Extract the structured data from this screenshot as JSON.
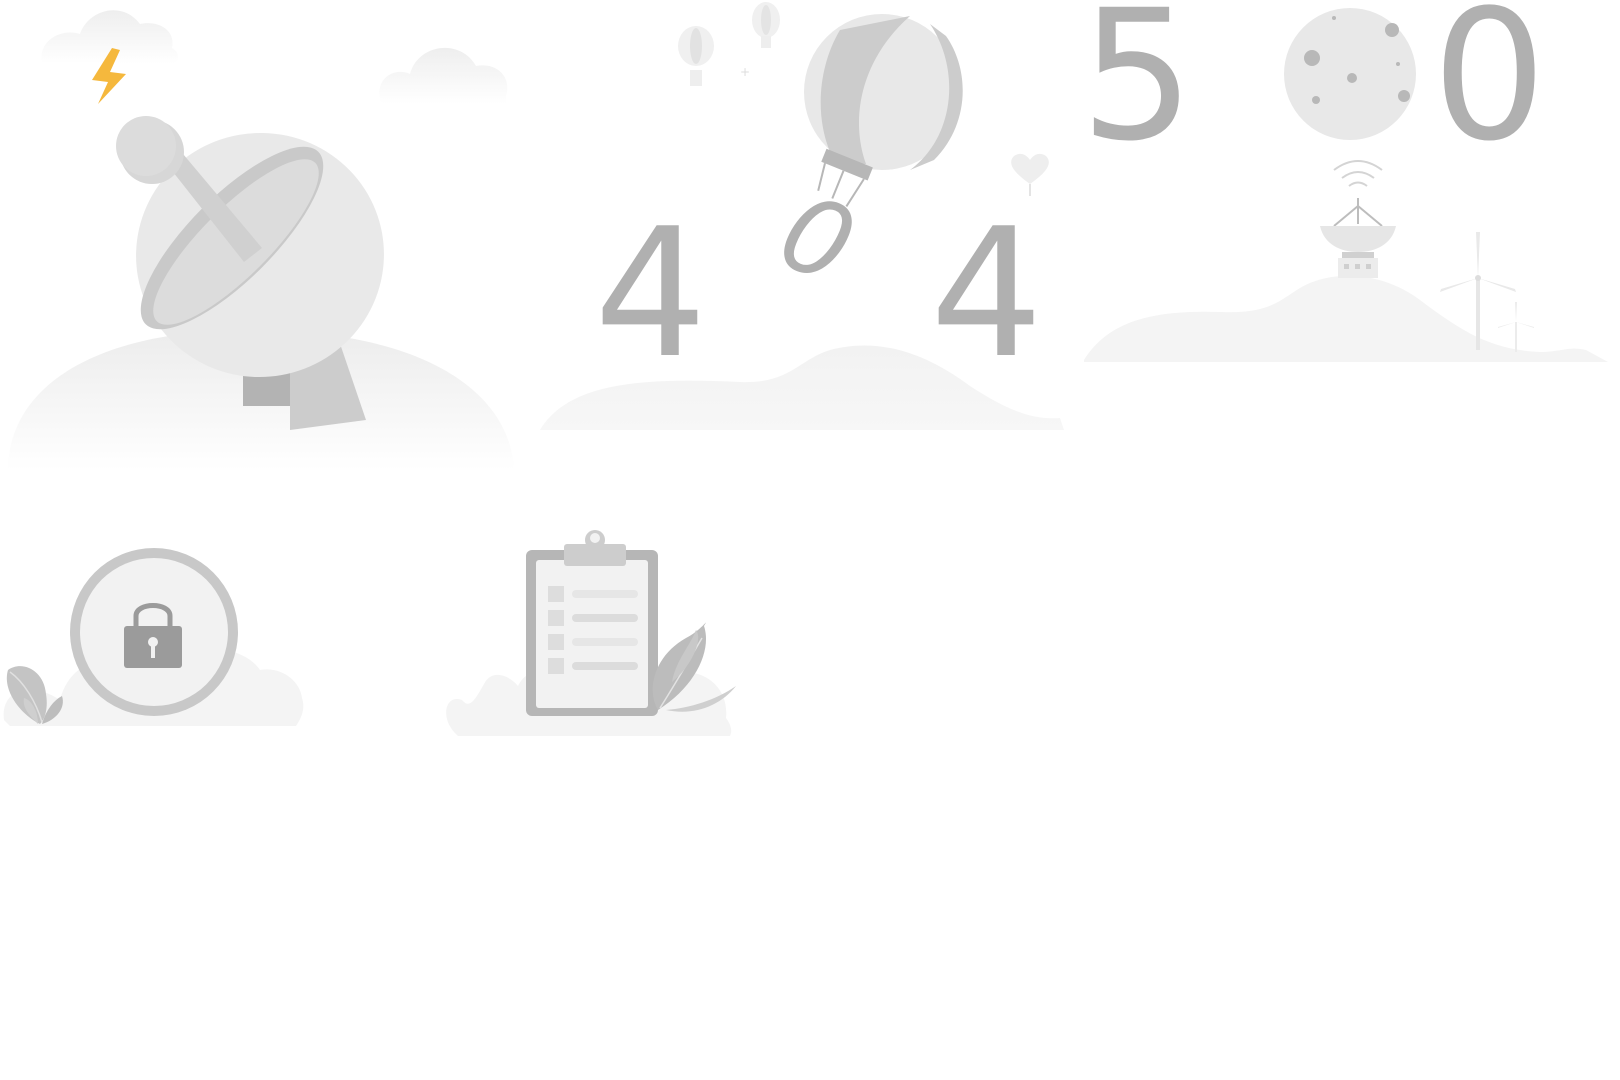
{
  "colors": {
    "background": "#ffffff",
    "digit": "#b0b0b0",
    "light_fill": "#e9e9e9",
    "mid_fill": "#cbcbcb",
    "dark_fill": "#9b9b9b",
    "ground": "#f4f4f4",
    "lightning": "#f5b83d"
  },
  "illustrations": {
    "network_error": {
      "icons": [
        "cloud-icon",
        "lightning-icon",
        "satellite-dish-icon"
      ]
    },
    "not_found": {
      "digits": {
        "first": "4",
        "middle": "0",
        "last": "4"
      },
      "icons": [
        "hot-air-balloon-icon",
        "heart-icon"
      ]
    },
    "server_error": {
      "digits": {
        "first": "5",
        "last": "0"
      },
      "icons": [
        "moon-icon",
        "radar-station-icon",
        "wind-turbine-icon"
      ]
    },
    "no_permission": {
      "icons": [
        "padlock-icon",
        "leaf-icon"
      ]
    },
    "empty_data": {
      "icons": [
        "clipboard-icon",
        "feather-icon"
      ]
    }
  }
}
